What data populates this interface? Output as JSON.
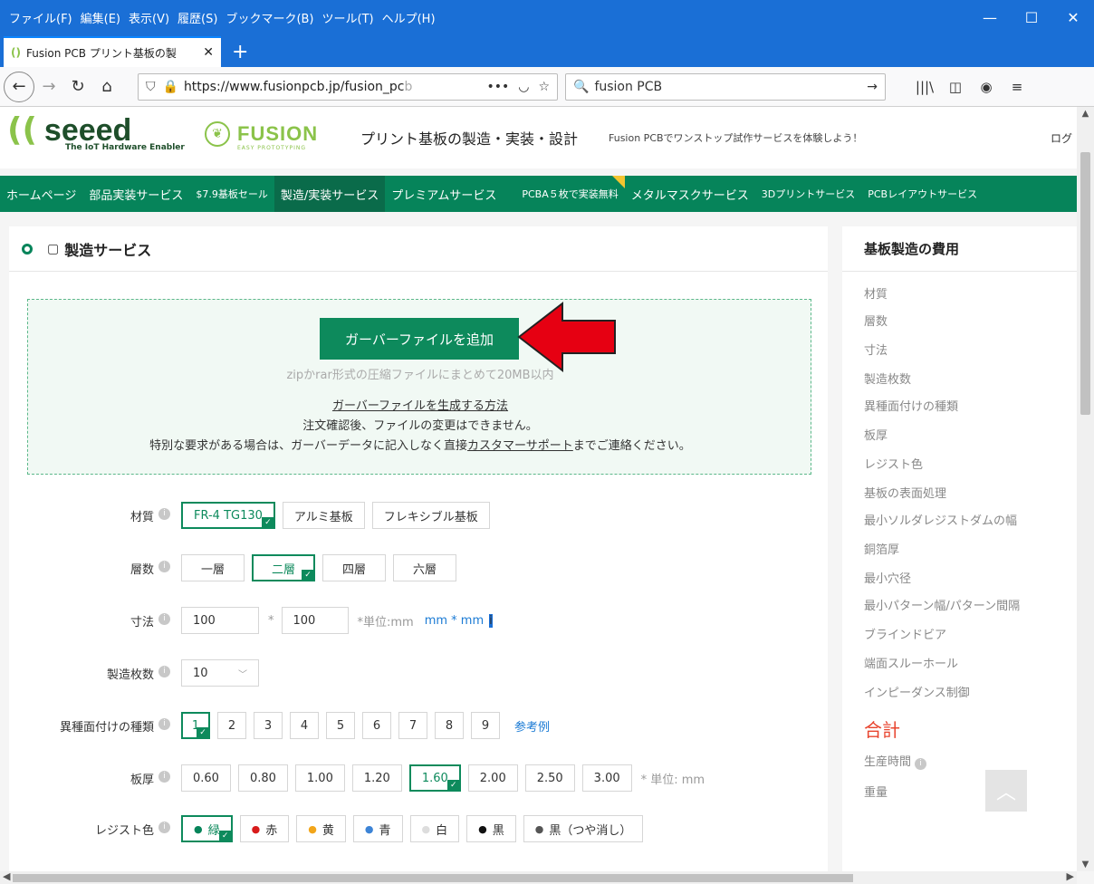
{
  "menu": [
    "ファイル(F)",
    "編集(E)",
    "表示(V)",
    "履歴(S)",
    "ブックマーク(B)",
    "ツール(T)",
    "ヘルプ(H)"
  ],
  "window": {
    "min": "—",
    "max": "☐",
    "close": "✕"
  },
  "tab": {
    "title": "Fusion PCB プリント基板の製",
    "close": "✕",
    "new": "+"
  },
  "nav": {
    "url_main": "https://www.fusionpcb.jp/fusion_pc",
    "url_fade": "b",
    "more": "•••",
    "search_value": "fusion PCB"
  },
  "site": {
    "seeed": "seeed",
    "seeed_sub": "The IoT Hardware Enabler",
    "fusion": "FUSION",
    "fusion_sub": "EASY PROTOTYPING",
    "tagline": "プリント基板の製造・実装・設計",
    "promo": "Fusion PCBでワンストップ試作サービスを体験しよう！",
    "login": "ログ"
  },
  "greennav": [
    "ホームページ",
    "部品実装サービス",
    "$7.9基板セール",
    "製造/実装サービス",
    "プレミアムサービス",
    "PCBA５枚で実装無料",
    "メタルマスクサービス",
    "3Dプリントサービス",
    "PCBレイアウトサービス"
  ],
  "main": {
    "title": "製造サービス",
    "upload_button": "ガーバーファイルを追加",
    "upload_hint": "zipかrar形式の圧縮ファイルにまとめて20MB以内",
    "howto_link": "ガーバーファイルを生成する方法",
    "note1": "注文確認後、ファイルの変更はできません。",
    "note2_pre": "特別な要求がある場合は、ガーバーデータに記入しなく直接",
    "note2_link": "カスタマーサポート",
    "note2_post": "までご連絡ください。"
  },
  "form": {
    "material": {
      "label": "材質",
      "options": [
        "FR-4 TG130",
        "アルミ基板",
        "フレキシブル基板"
      ]
    },
    "layers": {
      "label": "層数",
      "options": [
        "一層",
        "二層",
        "四層",
        "六層"
      ]
    },
    "size": {
      "label": "寸法",
      "w": "100",
      "x": "*",
      "h": "100",
      "unit": "*単位:mm",
      "unit_link": "mm * mm"
    },
    "qty": {
      "label": "製造枚数",
      "value": "10"
    },
    "panel": {
      "label": "異種面付けの種類",
      "options": [
        "1",
        "2",
        "3",
        "4",
        "5",
        "6",
        "7",
        "8",
        "9"
      ],
      "ref": "参考例"
    },
    "thickness": {
      "label": "板厚",
      "options": [
        "0.60",
        "0.80",
        "1.00",
        "1.20",
        "1.60",
        "2.00",
        "2.50",
        "3.00"
      ],
      "unit": "* 単位: mm"
    },
    "resist": {
      "label": "レジスト色",
      "options": [
        "緑",
        "赤",
        "黄",
        "青",
        "白",
        "黒",
        "黒（つや消し）"
      ]
    }
  },
  "colors": {
    "green": "#06845a",
    "red": "#d81b1b",
    "yellow": "#f2a51a",
    "blue": "#3d84d6",
    "white": "#dddddd",
    "black": "#111111",
    "matte": "#555555"
  },
  "sidebar": {
    "title": "基板製造の費用",
    "items": [
      "材質",
      "層数",
      "寸法",
      "製造枚数",
      "異種面付けの種類",
      "板厚",
      "レジスト色",
      "基板の表面処理",
      "最小ソルダレジストダムの幅",
      "銅箔厚",
      "最小穴径",
      "最小パターン幅/パターン間隔",
      "ブラインドビア",
      "端面スルーホール",
      "インピーダンス制御"
    ],
    "total": "合計",
    "lead_time": "生産時間",
    "weight": "重量",
    "to_top": "︿"
  }
}
